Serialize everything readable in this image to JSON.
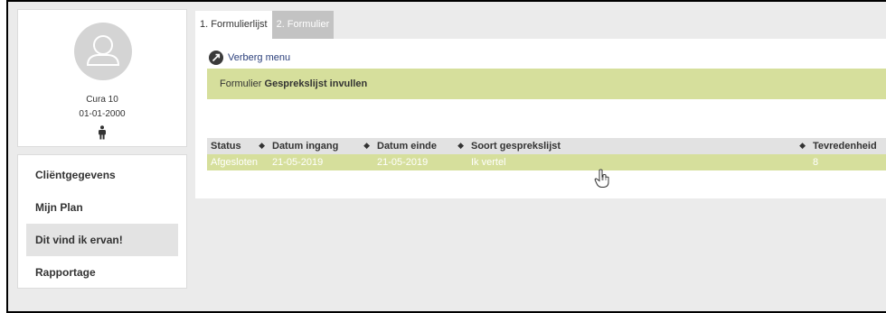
{
  "client": {
    "name": "Cura 10",
    "dob": "01-01-2000"
  },
  "sidebar": {
    "items": [
      {
        "label": "Cliëntgegevens"
      },
      {
        "label": "Mijn Plan"
      },
      {
        "label": "Dit vind ik ervan!"
      },
      {
        "label": "Rapportage"
      }
    ],
    "active_index": 2
  },
  "tabs": [
    {
      "label": "1. Formulierlijst"
    },
    {
      "label": "2. Formulier"
    }
  ],
  "toolbar": {
    "hide_menu_label": "Verberg menu"
  },
  "banner": {
    "prefix": "Formulier",
    "title": "Gesprekslijst invullen"
  },
  "table": {
    "columns": [
      "Status",
      "Datum ingang",
      "Datum einde",
      "Soort gesprekslijst",
      "Tevredenheid"
    ],
    "rows": [
      [
        "Afgesloten",
        "21-05-2019",
        "21-05-2019",
        "Ik vertel",
        "8"
      ]
    ]
  },
  "colors": {
    "accent_green": "#d6df9c",
    "header_gray": "#e2e2e2",
    "background": "#ebebeb"
  },
  "icons": {
    "avatar": "person-outline-icon",
    "gender": "male-figure-icon",
    "hide_menu": "arrow-circle-icon",
    "sort": "sort-updown-icon",
    "cursor": "hand-pointer-icon"
  }
}
